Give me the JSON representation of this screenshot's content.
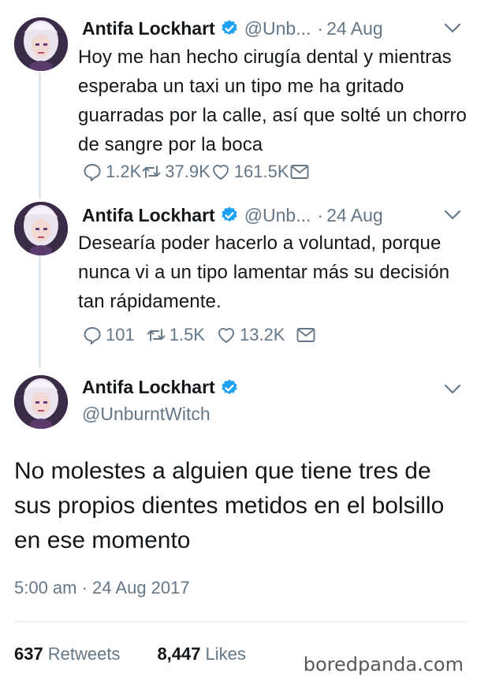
{
  "tweets": [
    {
      "name": "Antifa Lockhart",
      "handle": "@Unb...",
      "separator": "·",
      "date": "24 Aug",
      "text": "Hoy me han hecho cirugía dental y mientras esperaba un taxi un tipo me ha gritado guarradas por la calle, así que solté un chorro de sangre por la boca",
      "replies": "1.2K",
      "retweets": "37.9K",
      "likes": "161.5K"
    },
    {
      "name": "Antifa Lockhart",
      "handle": "@Unb...",
      "separator": "·",
      "date": "24 Aug",
      "text": "Desearía poder hacerlo a voluntad, porque nunca vi a un tipo lamentar más su decisión tan rápidamente.",
      "replies": "101",
      "retweets": "1.5K",
      "likes": "13.2K"
    }
  ],
  "main_tweet": {
    "name": "Antifa Lockhart",
    "handle": "@UnburntWitch",
    "text": "No molestes a alguien que tiene tres de sus propios dientes metidos en el bolsillo en ese momento",
    "timestamp": "5:00 am · 24 Aug 2017",
    "retweet_count": "637",
    "retweet_label": "Retweets",
    "like_count": "8,447",
    "like_label": "Likes"
  },
  "watermark": "boredpanda.com",
  "colors": {
    "verified": "#1da1f2",
    "muted": "#657786",
    "divider": "#e1e8ed",
    "text": "#14171a"
  },
  "icons": [
    "verified-badge-icon",
    "chevron-down-icon",
    "reply-icon",
    "retweet-icon",
    "like-icon",
    "dm-icon"
  ]
}
